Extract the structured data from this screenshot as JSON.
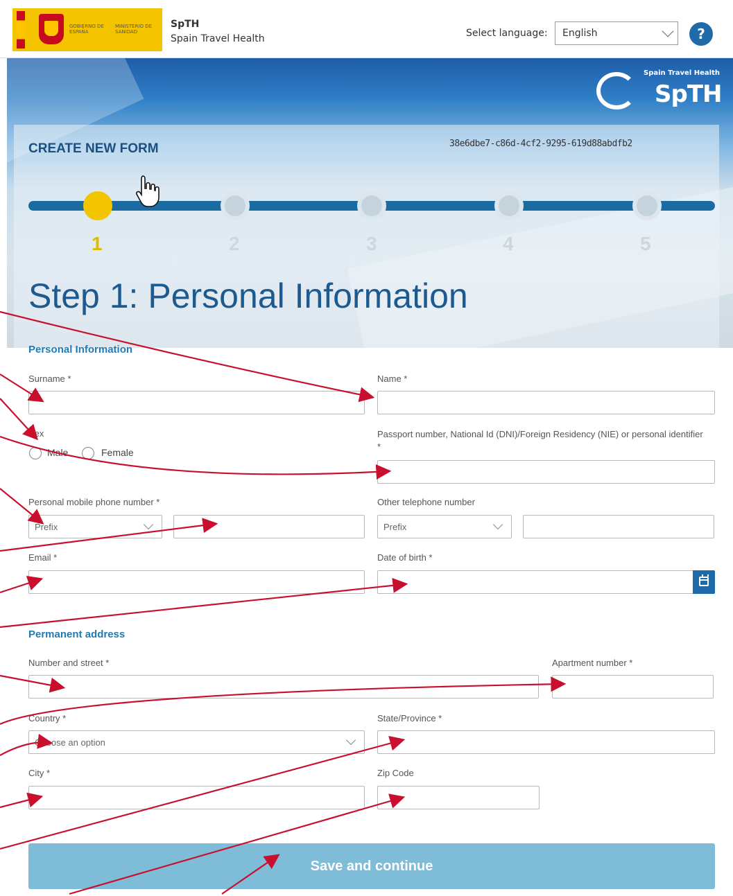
{
  "header": {
    "gov_text_1": "GOBIERNO DE ESPAÑA",
    "gov_text_2": "MINISTERIO DE SANIDAD",
    "app_name": "SpTH",
    "app_subtitle": "Spain Travel Health",
    "language_label": "Select language:",
    "language_value": "English",
    "help_label": "?"
  },
  "brand": {
    "tagline": "Spain Travel Health",
    "logo_text": "SpTH"
  },
  "form_header": {
    "title": "CREATE NEW FORM",
    "form_id": "38e6dbe7-c86d-4cf2-9295-619d88abdfb2"
  },
  "stepper": {
    "steps": [
      "1",
      "2",
      "3",
      "4",
      "5"
    ],
    "current": 1
  },
  "step_title": "Step 1: Personal Information",
  "personal": {
    "section": "Personal Information",
    "surname_label": "Surname *",
    "name_label": "Name *",
    "sex_label": "Sex",
    "male_label": "Male",
    "female_label": "Female",
    "id_label": "Passport number, National Id (DNI)/Foreign Residency (NIE) or personal identifier *",
    "mobile_label": "Personal mobile phone number *",
    "mobile_prefix": "Prefix",
    "other_phone_label": "Other telephone number",
    "other_prefix": "Prefix",
    "email_label": "Email *",
    "dob_label": "Date of birth *"
  },
  "address": {
    "section": "Permanent address",
    "street_label": "Number and street *",
    "apt_label": "Apartment number *",
    "country_label": "Country *",
    "country_value": "Choose an option",
    "state_label": "State/Province *",
    "city_label": "City *",
    "zip_label": "Zip Code"
  },
  "actions": {
    "save_label": "Save and continue"
  },
  "colors": {
    "primary": "#1f6aa8",
    "step_active": "#f2c500",
    "annotation_arrow": "#c8102e",
    "save_button": "#7fbcd8"
  }
}
